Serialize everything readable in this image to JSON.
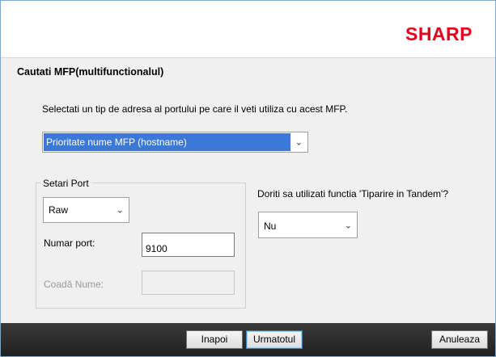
{
  "brand": {
    "logo_text": "SHARP",
    "logo_color": "#e5001e"
  },
  "page": {
    "title": "Cautati MFP(multifunctionalul)"
  },
  "instruction": "Selectati un tip de adresa al portului pe care il veti utiliza cu acest MFP.",
  "address_type": {
    "selected": "Prioritate nume MFP (hostname)",
    "chevron_icon": "chevron-down-icon"
  },
  "port_settings": {
    "group_title": "Setari Port",
    "protocol": {
      "selected": "Raw"
    },
    "port_number": {
      "label": "Numar port:",
      "value": "9100"
    },
    "queue_name": {
      "label": "Coadă Nume:",
      "value": ""
    }
  },
  "tandem": {
    "question": "Doriti sa utilizati functia 'Tiparire in Tandem'?",
    "selected": "Nu"
  },
  "footer": {
    "back_label": "Inapoi",
    "next_label": "Urmatotul",
    "cancel_label": "Anuleaza"
  },
  "colors": {
    "selection_blue": "#3c78d8",
    "footer_dark": "#2a2a2a",
    "accent_focus": "#3c7fb1"
  }
}
